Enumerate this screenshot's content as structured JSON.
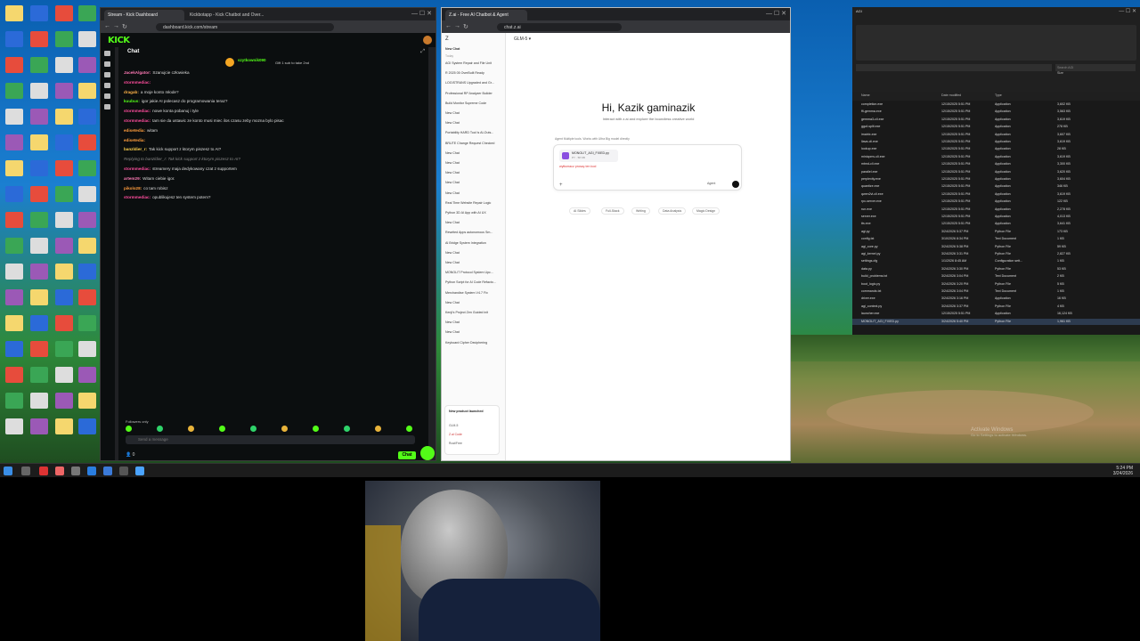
{
  "browser1": {
    "tabs": [
      "Stream - Kick Dashboard",
      "Kickbotapp - Kick Chatbot and Over..."
    ],
    "url": "dashboard.kick.com/stream",
    "kick_logo": "KICK",
    "chat_title": "Chat",
    "gift_user": "szytkownik090",
    "gift_text": "Gift 1 sub to take 2nd",
    "messages": [
      {
        "user": "JacekAlgator:",
        "text": "Szanujcie człowieka",
        "color": "#ff7ab6"
      },
      {
        "user": "stormmediac:",
        "text": "",
        "color": "#ff4d9e"
      },
      {
        "user": "dragab:",
        "text": "a moje konto młode?",
        "color": "#ffb347"
      },
      {
        "user": "kuubus:",
        "text": "igor jakie AI polecasz do programowania teraz?",
        "color": "#53fc18"
      },
      {
        "user": "stormmediac:",
        "text": "nowe konta pobanuj i tyle",
        "color": "#ff4d9e"
      },
      {
        "user": "stormmediac:",
        "text": "tam sie da ustawic ze konto musi miec ilos czasu zeby mozna bylo pisac",
        "color": "#ff4d9e"
      },
      {
        "user": "edisetedia:",
        "text": "witam",
        "color": "#ff9d3d"
      },
      {
        "user": "edisetedia:",
        "text": "",
        "color": "#ff9d3d"
      },
      {
        "user": "banzldier_r:",
        "text": "Tak kick support z ktorym piszesz to AI?",
        "color": "#ffd24d"
      },
      {
        "user": "",
        "text": "Replying to banzldier_r: Tak kick support z ktorym piszesz to AI?",
        "color": "#888"
      },
      {
        "user": "stormmediac:",
        "text": "streamery maja dedykowany czat z supportem",
        "color": "#ff4d9e"
      },
      {
        "user": "artem29:",
        "text": "Witam ciebie igor.",
        "color": "#ff7ab6"
      },
      {
        "user": "pikolo28:",
        "text": "co tam robisz",
        "color": "#ff9d3d"
      },
      {
        "user": "stormmediac:",
        "text": "opublikujesz ten system potem?",
        "color": "#ff4d9e"
      }
    ],
    "followers_only": "Followers only",
    "input_placeholder": "Send a message",
    "viewer_count": "0",
    "chat_button": "Chat"
  },
  "browser2": {
    "tab": "Z.ai - Free AI Chatbot & Agent",
    "url": "chat.z.ai",
    "model": "GLM-5",
    "sidebar": {
      "new_chat": "New Chat",
      "sections": [
        "Today",
        "Yesterday",
        "Previous 7 Days"
      ],
      "items": [
        "AGI System Repair and File Unit",
        "R 2025 05 OverBuilt Ready",
        "LOGISTRANS Upgraded and Gr...",
        "Professional RP Analyzer Builder",
        "Build Monitor Supreme Code",
        "New Chat",
        "New Chat",
        "Portability HARD Tool Is AI-Outs...",
        "BRUTE Change Request Checked",
        "New Chat",
        "New Chat",
        "New Chat",
        "New Chat",
        "New Chat",
        "Real Time Website Repair Logic",
        "Python 3D AI App with AI UX",
        "New Chat",
        "Rewrited Apps autonomous Sm...",
        "AI Bridge System Integration",
        "New Chat",
        "New Chat",
        "MONOLIT Protocol System Upc...",
        "Python Script for AI Code Refacto...",
        "Merchandise System V4.7 Fix",
        "New Chat",
        "Kenji's Project Zen Guided init",
        "New Chat",
        "New Chat",
        "Keyboard Cipher Deciphering"
      ],
      "promo_title": "New product launched",
      "promo_items": [
        "GLM-5",
        "Z.ai Code",
        "Rust/Free"
      ]
    },
    "greeting": "Hi, Kazik gaminazik",
    "subgreeting": "Interact with z.ai and explore the boundless creative world",
    "notice": "Agent Multiple tools. Works with Ultra Big model directly",
    "file_name": "MONOLIT_AGI_FIXED.py",
    "file_meta": "PY · 58 KB",
    "input_text": "wytłumacz proszę ten kod",
    "agent_label": "Agent",
    "chips": [
      "AI Slides",
      "Full-Stack",
      "Writing",
      "Data Analysis",
      "Magic Design"
    ]
  },
  "explorer": {
    "path": "AGI",
    "search": "Search AGI",
    "columns": [
      "Name",
      "Date modified",
      "Type",
      "Size"
    ],
    "rows": [
      [
        "completion.exe",
        "12/15/2025 5:51 PM",
        "Application",
        "3,602 KB"
      ],
      [
        "ffi-gemma.exe",
        "12/15/2025 5:51 PM",
        "Application",
        "3,563 KB"
      ],
      [
        "gemma3-cli.exe",
        "12/15/2025 5:51 PM",
        "Application",
        "3,619 KB"
      ],
      [
        "gguf-split.exe",
        "12/15/2025 5:51 PM",
        "Application",
        "278 KB"
      ],
      [
        "imatrix.exe",
        "12/15/2025 5:51 PM",
        "Application",
        "3,607 KB"
      ],
      [
        "llava-cli.exe",
        "12/15/2025 5:51 PM",
        "Application",
        "3,619 KB"
      ],
      [
        "lookup.exe",
        "12/15/2025 5:51 PM",
        "Application",
        "28 KB"
      ],
      [
        "minicpmv-cli.exe",
        "12/15/2025 5:51 PM",
        "Application",
        "3,619 KB"
      ],
      [
        "mtmd-cli.exe",
        "12/15/2025 5:51 PM",
        "Application",
        "3,300 KB"
      ],
      [
        "parallel.exe",
        "12/15/2025 5:51 PM",
        "Application",
        "3,620 KB"
      ],
      [
        "perplexity.exe",
        "12/15/2025 5:51 PM",
        "Application",
        "3,604 KB"
      ],
      [
        "quantize.exe",
        "12/15/2025 5:51 PM",
        "Application",
        "346 KB"
      ],
      [
        "qwen2vl-cli.exe",
        "12/15/2025 5:51 PM",
        "Application",
        "3,619 KB"
      ],
      [
        "rpc-server.exe",
        "12/15/2025 5:51 PM",
        "Application",
        "122 KB"
      ],
      [
        "run.exe",
        "12/15/2025 5:51 PM",
        "Application",
        "2,278 KB"
      ],
      [
        "server.exe",
        "12/15/2025 5:51 PM",
        "Application",
        "4,013 KB"
      ],
      [
        "tts.exe",
        "12/15/2025 5:51 PM",
        "Application",
        "3,641 KB"
      ],
      [
        "agi.py",
        "3/24/2026 5:37 PM",
        "Python File",
        "173 KB"
      ],
      [
        "config.txt",
        "3/10/2026 8:34 PM",
        "Text Document",
        "1 KB"
      ],
      [
        "agi_core.py",
        "3/24/2026 5:38 PM",
        "Python File",
        "59 KB"
      ],
      [
        "agi_kernel.py",
        "3/24/2026 3:31 PM",
        "Python File",
        "2,827 KB"
      ],
      [
        "settings.cfg",
        "1/1/2026 8:45 AM",
        "Configuration sett...",
        "1 KB"
      ],
      [
        "data.py",
        "3/24/2026 3:30 PM",
        "Python File",
        "53 KB"
      ],
      [
        "build_problems.txt",
        "3/24/2026 3:04 PM",
        "Text Document",
        "2 KB"
      ],
      [
        "boot_logic.py",
        "3/24/2026 3:20 PM",
        "Python File",
        "5 KB"
      ],
      [
        "commands.txt",
        "3/24/2026 3:04 PM",
        "Text Document",
        "1 KB"
      ],
      [
        "driver.exe",
        "3/24/2026 3:16 PM",
        "Application",
        "16 KB"
      ],
      [
        "agi_context.py",
        "3/24/2026 3:37 PM",
        "Python File",
        "4 KB"
      ],
      [
        "launcher.exe",
        "12/15/2025 5:51 PM",
        "Application",
        "16,124 KB"
      ],
      [
        "MONOLIT_AGI_FIXED.py",
        "3/24/2026 5:40 PM",
        "Python File",
        "1,961 KB"
      ]
    ]
  },
  "desktop": {
    "activate_line1": "Activate Windows",
    "activate_line2": "Go to Settings to activate Windows."
  },
  "taskbar": {
    "time": "5:24 PM",
    "date": "3/24/2026"
  },
  "colors": {
    "kick_green": "#53fc18",
    "kick_bg": "#0b0e0f"
  }
}
